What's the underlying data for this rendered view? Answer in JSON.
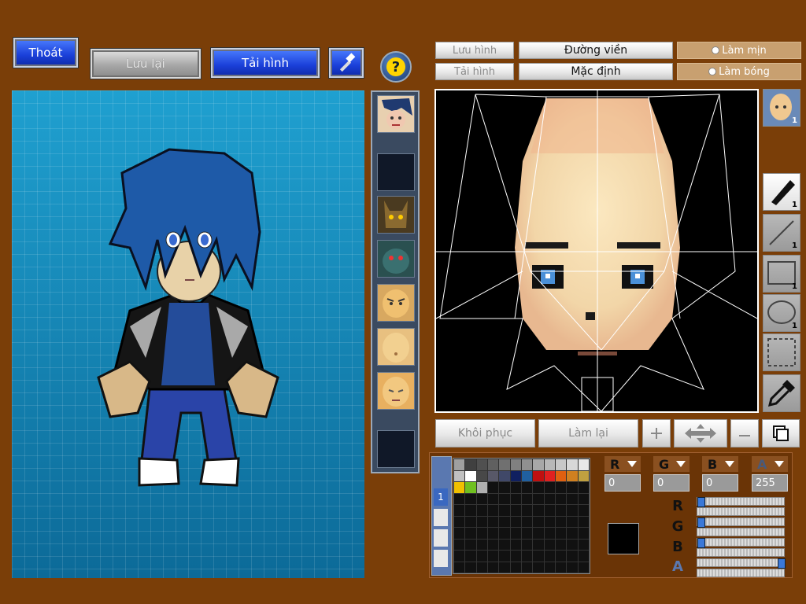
{
  "top_left": {
    "exit_label": "Thoát",
    "save_label": "Lưu lại",
    "load_label": "Tải hình"
  },
  "top_right": {
    "save_image_label": "Lưu hình",
    "load_image_label": "Tải hình",
    "outline_label": "Đường viền",
    "default_label": "Mặc định",
    "smooth_label": "Làm mịn",
    "shade_label": "Làm bóng"
  },
  "bottom_editor": {
    "restore_label": "Khôi phục",
    "redo_label": "Làm lại"
  },
  "tools": {
    "face_preview_count": "1",
    "pen_count": "1",
    "line_count": "1",
    "rect_count": "1",
    "ellipse_count": "1"
  },
  "color": {
    "r_value": "0",
    "g_value": "0",
    "b_value": "0",
    "a_value": "255",
    "current_color": "#000000",
    "palette_row1": [
      "#a0a0a0",
      "#404040",
      "#505050",
      "#606060",
      "#707070",
      "#808080",
      "#909090",
      "#a8a8a8",
      "#b8b8b8",
      "#c8c8c8",
      "#d8d8d8",
      "#e8e8e8"
    ],
    "palette_row2": [
      "#c0c0c0",
      "#ffffff",
      "#484848",
      "#585868",
      "#404868",
      "#102060",
      "#2060a0",
      "#c01010",
      "#e02020",
      "#e06010",
      "#d08020",
      "#c0a040"
    ],
    "palette_row3": [
      "#f0c000",
      "#70c020",
      "#b0b0b0"
    ]
  },
  "palette_tabs": [
    "1"
  ]
}
